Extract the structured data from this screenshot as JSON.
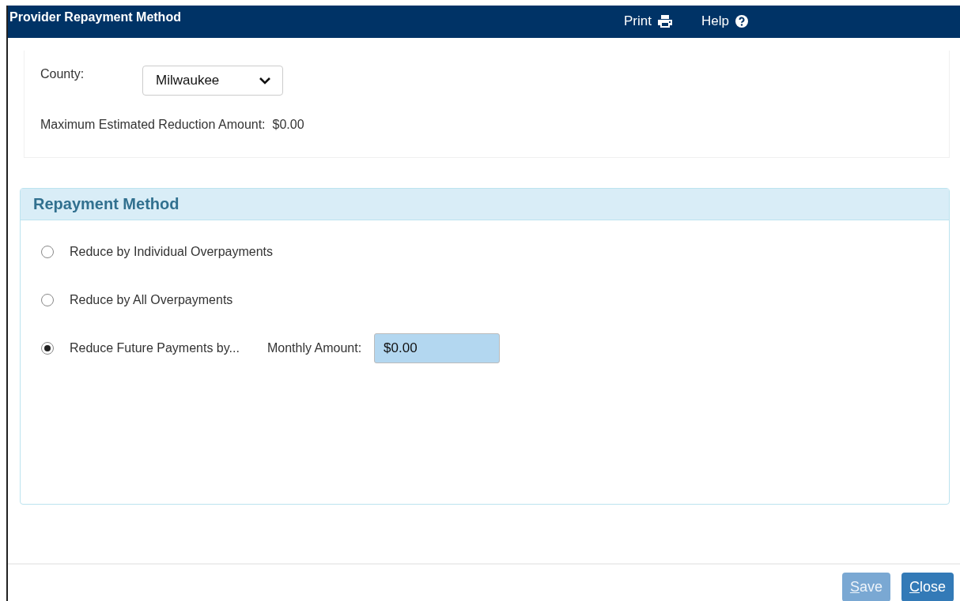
{
  "window": {
    "title": "Provider Repayment Method",
    "actions": [
      {
        "label": "Print",
        "kind": "print"
      },
      {
        "label": "Help",
        "kind": "help"
      }
    ]
  },
  "county": {
    "label": "County:",
    "value": "Milwaukee"
  },
  "max_reduction": {
    "label": "Maximum Estimated Reduction Amount:",
    "value": "$0.00"
  },
  "repayment": {
    "title": "Repayment Method",
    "options": [
      {
        "label": "Reduce by Individual Overpayments",
        "selected": false
      },
      {
        "label": "Reduce by All Overpayments",
        "selected": false
      },
      {
        "label": "Reduce Future Payments by...",
        "selected": true,
        "field_label": "Monthly Amount:",
        "field_value": "$0.00"
      }
    ]
  },
  "buttons": [
    {
      "label": "Save",
      "first_letter_underlined": true,
      "disabled": true
    },
    {
      "label": "Close",
      "first_letter_underlined": true,
      "disabled": false
    }
  ]
}
